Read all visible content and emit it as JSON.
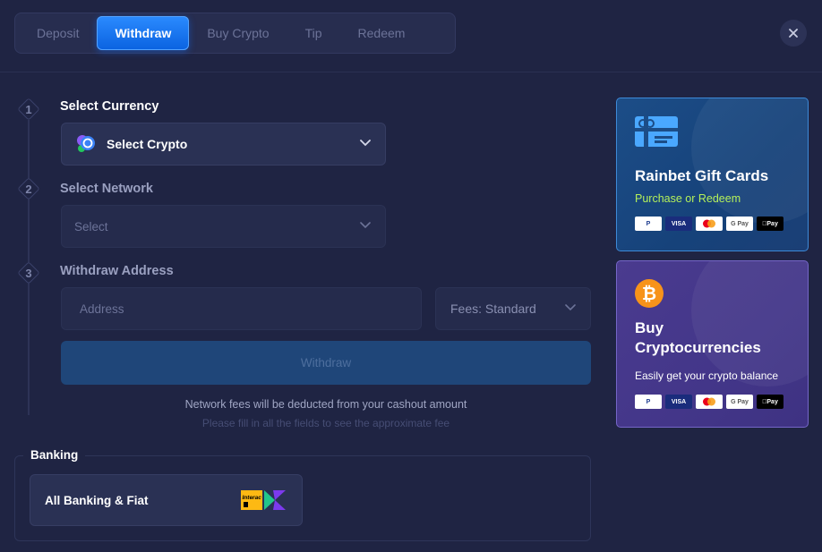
{
  "tabs": [
    {
      "label": "Deposit",
      "active": false
    },
    {
      "label": "Withdraw",
      "active": true
    },
    {
      "label": "Buy Crypto",
      "active": false
    },
    {
      "label": "Tip",
      "active": false
    },
    {
      "label": "Redeem",
      "active": false
    }
  ],
  "steps": [
    {
      "num": "1",
      "label": "Select Currency"
    },
    {
      "num": "2",
      "label": "Select Network"
    },
    {
      "num": "3",
      "label": "Withdraw Address"
    }
  ],
  "currency_select": {
    "value": "Select Crypto"
  },
  "network_select": {
    "value": "Select"
  },
  "address": {
    "placeholder": "Address"
  },
  "fees": {
    "value": "Fees: Standard"
  },
  "withdraw_button": {
    "label": "Withdraw"
  },
  "notes": {
    "network_fee": "Network fees will be deducted from your cashout amount",
    "fill_fields": "Please fill in all the fields to see the approximate fee"
  },
  "banking": {
    "title": "Banking",
    "item_label": "All Banking & Fiat",
    "interac_logo_text": "Interac"
  },
  "gift_card": {
    "title": "Rainbet Gift Cards",
    "subtitle": "Purchase or Redeem",
    "subtitle_color": "#b4f05a"
  },
  "buy_crypto_card": {
    "title_line1": "Buy",
    "title_line2": "Cryptocurrencies",
    "subtitle": "Easily get your crypto balance"
  },
  "payment_methods": {
    "paypal": "P",
    "visa": "VISA",
    "gpay": "G Pay",
    "apay": "Pay"
  },
  "colors": {
    "background": "#1f2443",
    "accent": "#0a62e0",
    "gift_card_border": "#3d8ad8",
    "crypto_card_border": "#7566c8"
  }
}
